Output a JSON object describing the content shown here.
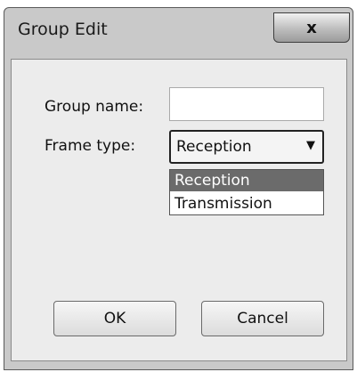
{
  "window": {
    "title": "Group Edit",
    "close_glyph": "x"
  },
  "form": {
    "group_name_label": "Group name:",
    "group_name_value": "",
    "frame_type_label": "Frame type:",
    "frame_type_value": "Reception",
    "dropdown_arrow": "▼",
    "frame_type_options": [
      "Reception",
      "Transmission"
    ]
  },
  "buttons": {
    "ok": "OK",
    "cancel": "Cancel"
  }
}
